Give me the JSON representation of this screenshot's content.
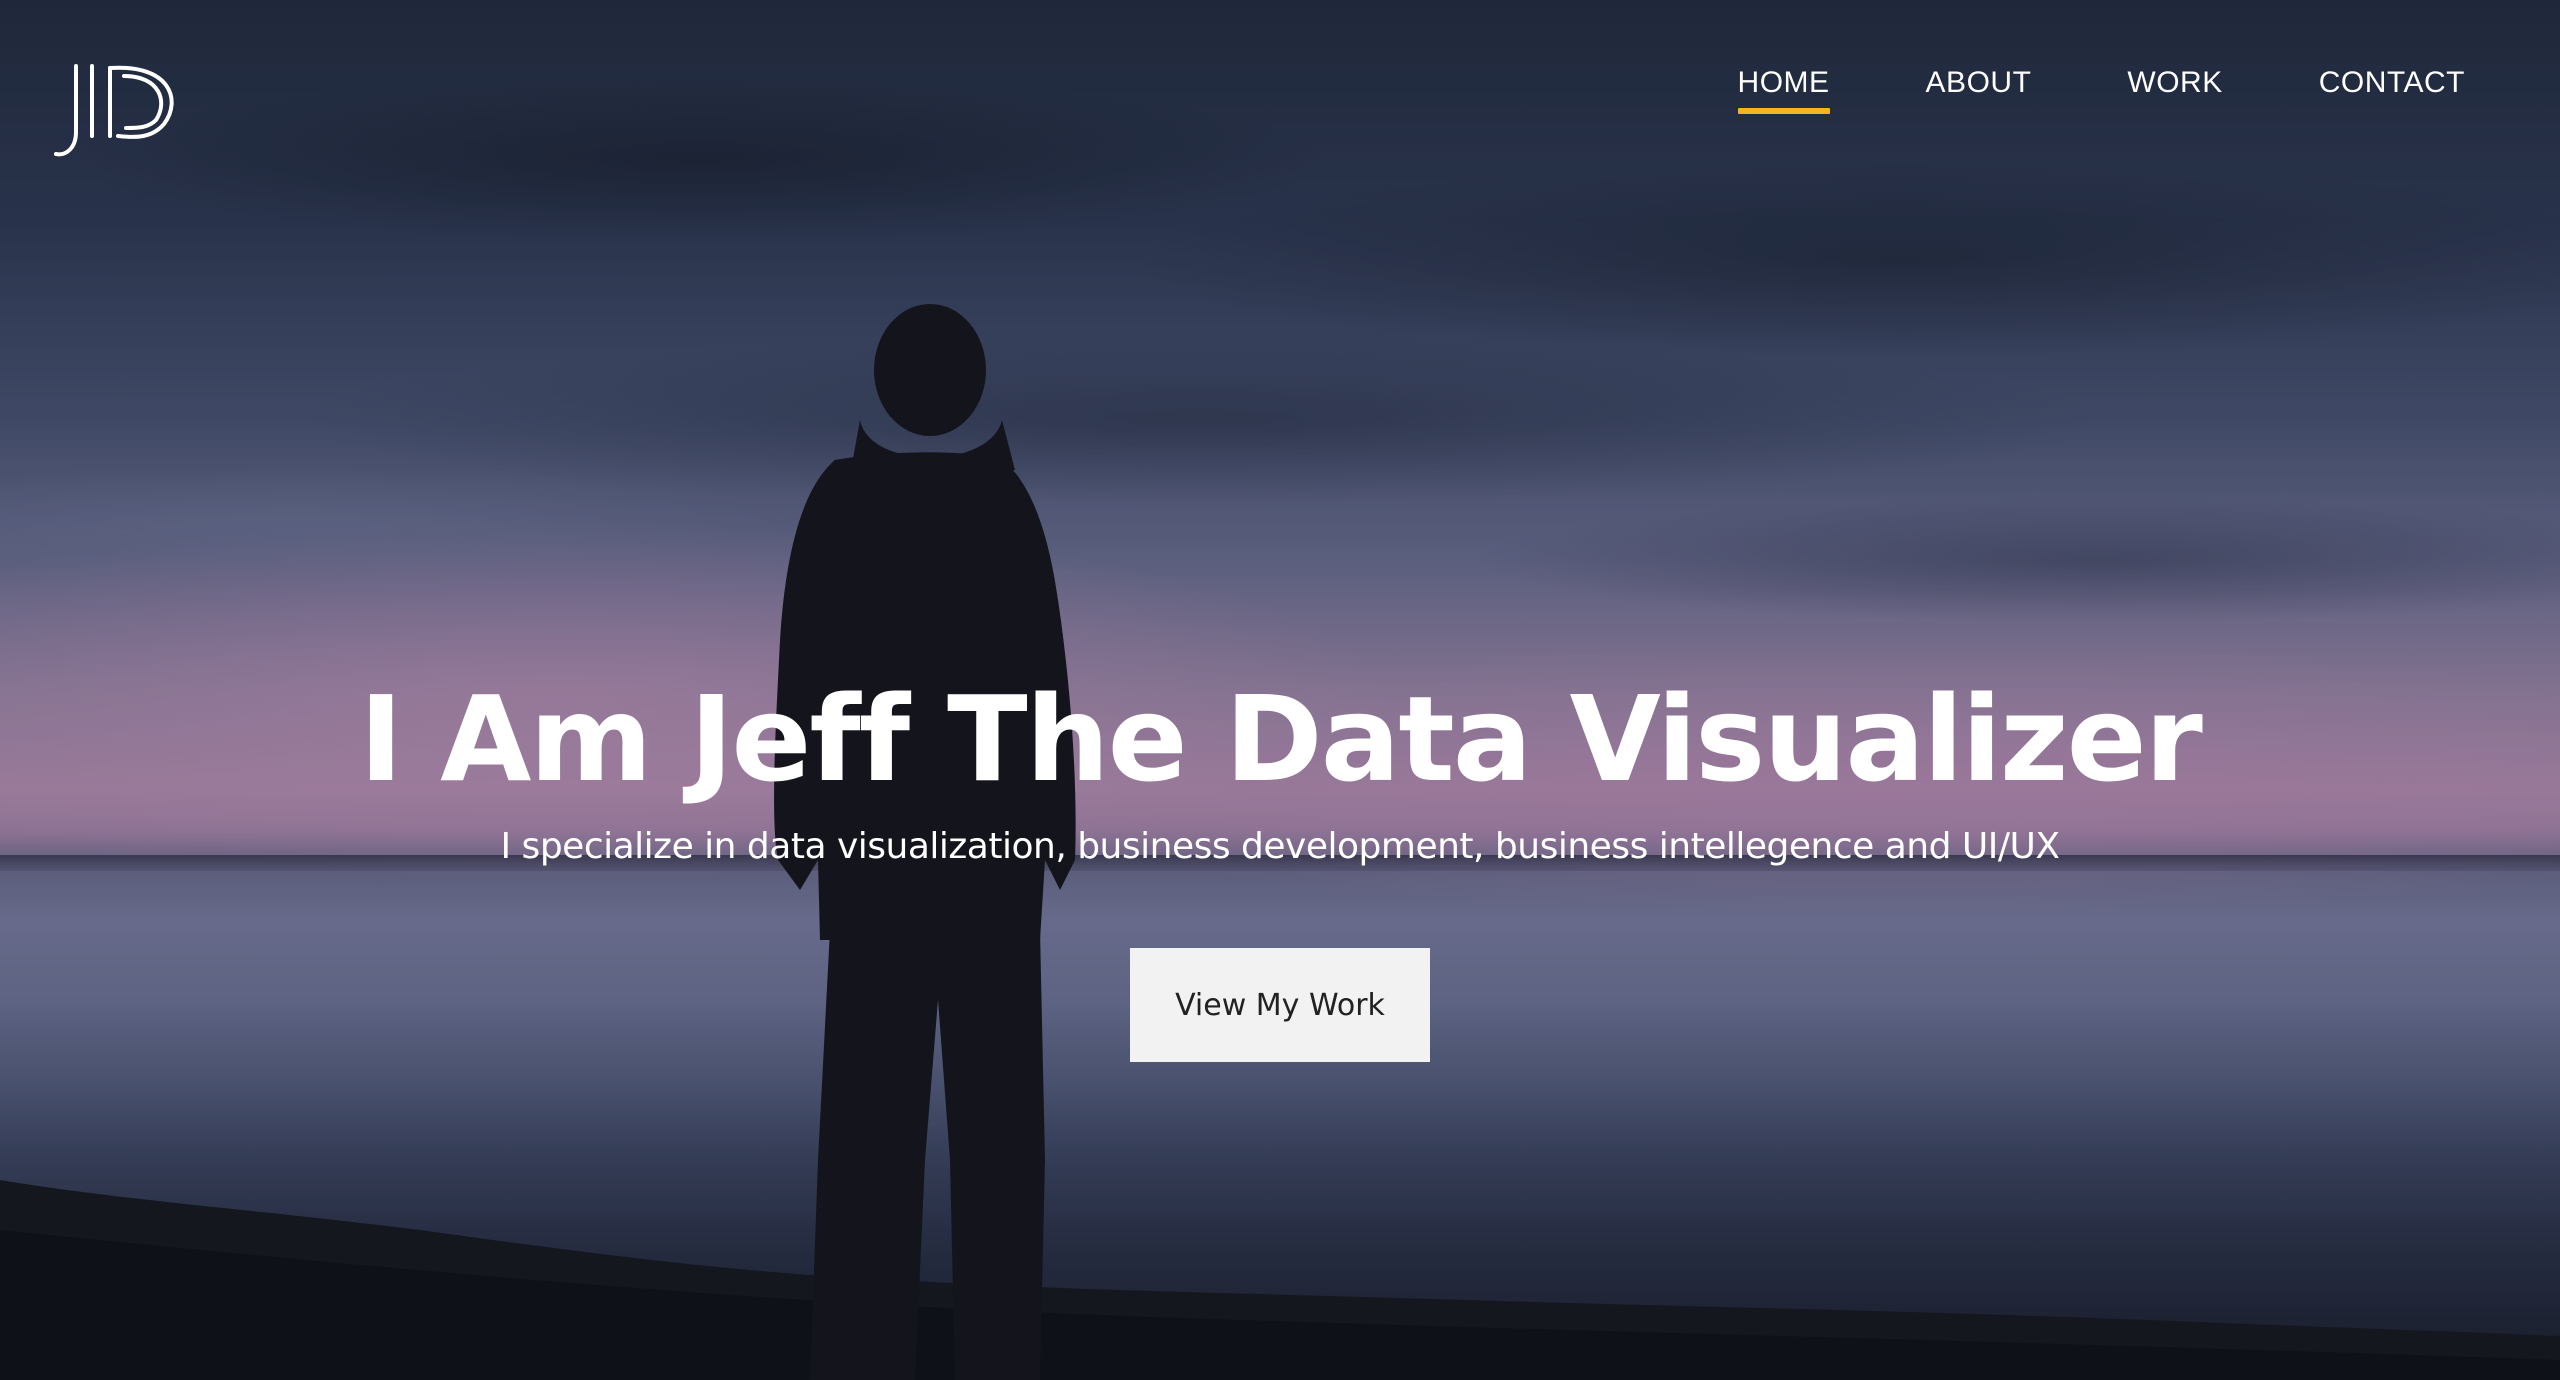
{
  "brand": {
    "logo_text": "JD",
    "logo_icon": "jd-monogram"
  },
  "nav": {
    "items": [
      {
        "label": "HOME",
        "active": true
      },
      {
        "label": "ABOUT",
        "active": false
      },
      {
        "label": "WORK",
        "active": false
      },
      {
        "label": "CONTACT",
        "active": false
      }
    ],
    "active_underline_color": "#f4b522"
  },
  "hero": {
    "title": "I Am Jeff The Data Visualizer",
    "subtitle": "I specialize in data visualization, business development, business intellegence and UI/UX",
    "cta_label": "View My Work",
    "background_image": "silhouette-lakeside-dusk"
  }
}
